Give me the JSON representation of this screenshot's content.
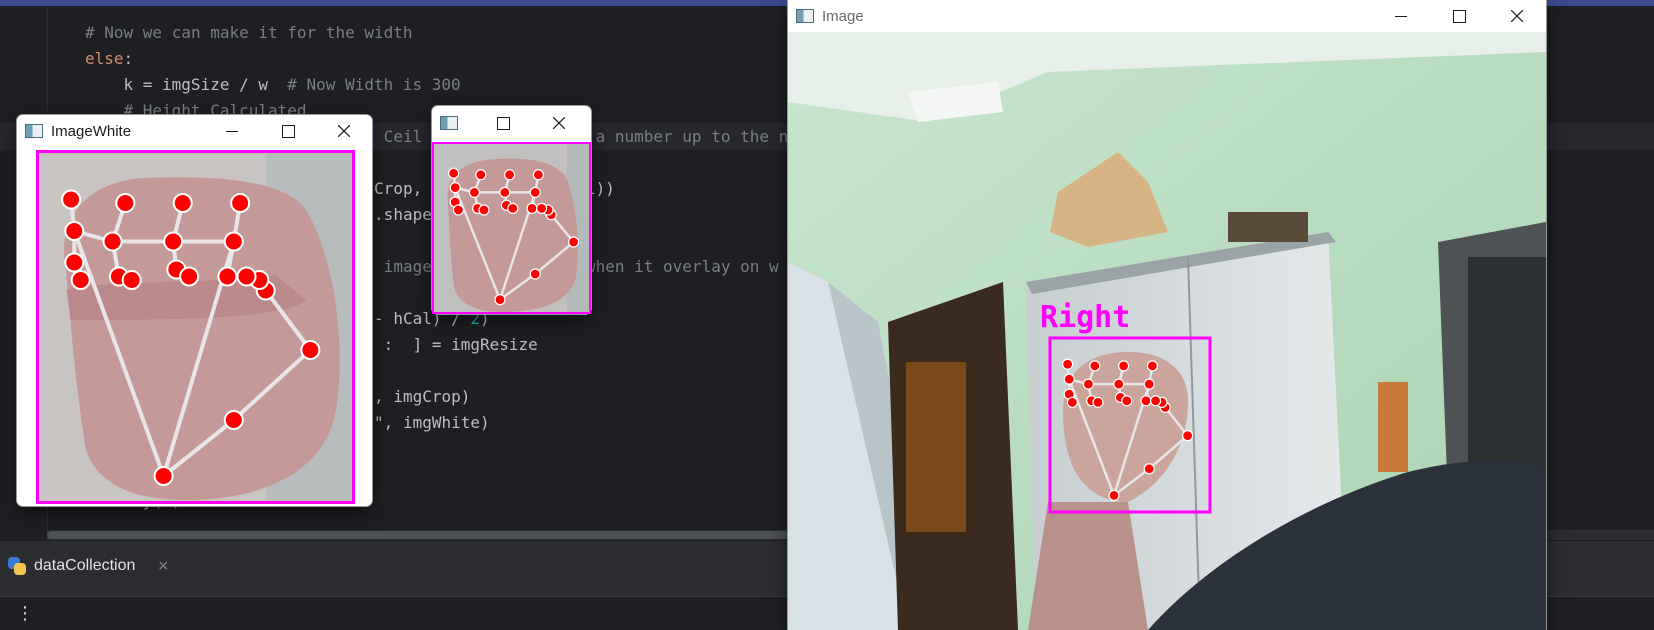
{
  "editor": {
    "lines": [
      {
        "indent": 2,
        "segments": [
          {
            "t": "# Now we can make it for the width",
            "c": "comment"
          }
        ]
      },
      {
        "indent": 2,
        "segments": [
          {
            "t": "else",
            "c": "keyword"
          },
          {
            "t": ":",
            "c": "plain"
          }
        ]
      },
      {
        "indent": 3,
        "segments": [
          {
            "t": "k = imgSize / w  ",
            "c": "plain"
          },
          {
            "t": "# Now Width is 300",
            "c": "comment"
          }
        ]
      },
      {
        "indent": 3,
        "segments": [
          {
            "t": "# Height Calculated",
            "c": "comment"
          }
        ]
      },
      {
        "indent": 0,
        "segments": [
          {
            "t": "                                       Ceil i                a number up to the ne",
            "c": "comment"
          }
        ]
      },
      {
        "indent": 0,
        "segments": []
      },
      {
        "indent": 0,
        "segments": [
          {
            "t": "                                      Crop, (             Cal))",
            "c": "plain"
          }
        ]
      },
      {
        "indent": 0,
        "segments": [
          {
            "t": "                                      .shape",
            "c": "plain"
          }
        ]
      },
      {
        "indent": 0,
        "segments": []
      },
      {
        "indent": 0,
        "segments": [
          {
            "t": "                                       image                when it overlay on w",
            "c": "comment"
          }
        ]
      },
      {
        "indent": 0,
        "segments": []
      },
      {
        "indent": 0,
        "segments": [
          {
            "t": "                                      - hCal) / ",
            "c": "plain"
          },
          {
            "t": "2",
            "c": "num"
          },
          {
            "t": ")",
            "c": "plain"
          }
        ]
      },
      {
        "indent": 0,
        "segments": [
          {
            "t": "                                       :  ] = imgResize",
            "c": "plain"
          }
        ]
      },
      {
        "indent": 0,
        "segments": []
      },
      {
        "indent": 0,
        "segments": [
          {
            "t": "                                      , imgCrop)",
            "c": "plain"
          }
        ]
      },
      {
        "indent": 0,
        "segments": [
          {
            "t": "                                      \", imgWhite)",
            "c": "plain"
          }
        ]
      },
      {
        "indent": 0,
        "segments": []
      },
      {
        "indent": 0,
        "segments": []
      },
      {
        "indent": 1,
        "segments": [
          {
            "t": "cv2.waitKey(1)",
            "c": "plain"
          }
        ]
      }
    ]
  },
  "run_panel": {
    "tab_label": "dataCollection",
    "close_glyph": "×",
    "menu_glyph": "⋮"
  },
  "windows": {
    "image_white": {
      "title": "ImageWhite"
    },
    "image_crop": {
      "title": ""
    },
    "image": {
      "title": "Image"
    }
  },
  "overlay": {
    "hand_label": "Right",
    "box_color": "#ff00ff",
    "landmark_color": "#ff0000",
    "connection_color": "#e6e6e6"
  },
  "icons": {
    "minimize": "minimize-icon",
    "maximize": "maximize-icon",
    "close": "close-icon",
    "python": "python-icon"
  }
}
